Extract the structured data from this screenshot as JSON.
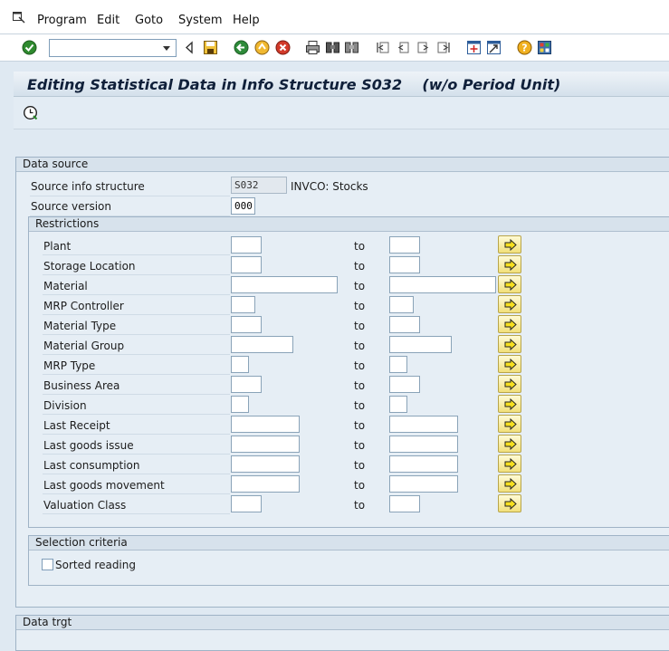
{
  "menu": [
    "Program",
    "Edit",
    "Goto",
    "System",
    "Help"
  ],
  "command_field": {
    "value": ""
  },
  "title": "Editing Statistical Data in Info Structure S032    (w/o Period Unit)",
  "data_source": {
    "title": "Data source",
    "source_info_structure_label": "Source info structure",
    "source_info_structure_value": "S032",
    "source_info_structure_desc": "INVCO: Stocks",
    "source_version_label": "Source version",
    "source_version_value": "000"
  },
  "restrictions": {
    "title": "Restrictions",
    "to_label": "to",
    "rows": [
      {
        "label": "Plant",
        "from": "",
        "to": ""
      },
      {
        "label": "Storage Location",
        "from": "",
        "to": ""
      },
      {
        "label": "Material",
        "from": "",
        "to": ""
      },
      {
        "label": "MRP Controller",
        "from": "",
        "to": ""
      },
      {
        "label": "Material Type",
        "from": "",
        "to": ""
      },
      {
        "label": "Material Group",
        "from": "",
        "to": ""
      },
      {
        "label": "MRP Type",
        "from": "",
        "to": ""
      },
      {
        "label": "Business Area",
        "from": "",
        "to": ""
      },
      {
        "label": "Division",
        "from": "",
        "to": ""
      },
      {
        "label": "Last Receipt",
        "from": "",
        "to": ""
      },
      {
        "label": "Last goods issue",
        "from": "",
        "to": ""
      },
      {
        "label": "Last consumption",
        "from": "",
        "to": ""
      },
      {
        "label": "Last goods movement",
        "from": "",
        "to": ""
      },
      {
        "label": "Valuation Class",
        "from": "",
        "to": ""
      }
    ]
  },
  "selection_criteria": {
    "title": "Selection criteria",
    "sorted_reading_label": "Sorted reading",
    "sorted_reading_checked": false
  },
  "data_target": {
    "title": "Data trgt"
  },
  "colors": {
    "background": "#dfe9f2",
    "title_text": "#10203a",
    "multi_button": "#f2e07a"
  }
}
